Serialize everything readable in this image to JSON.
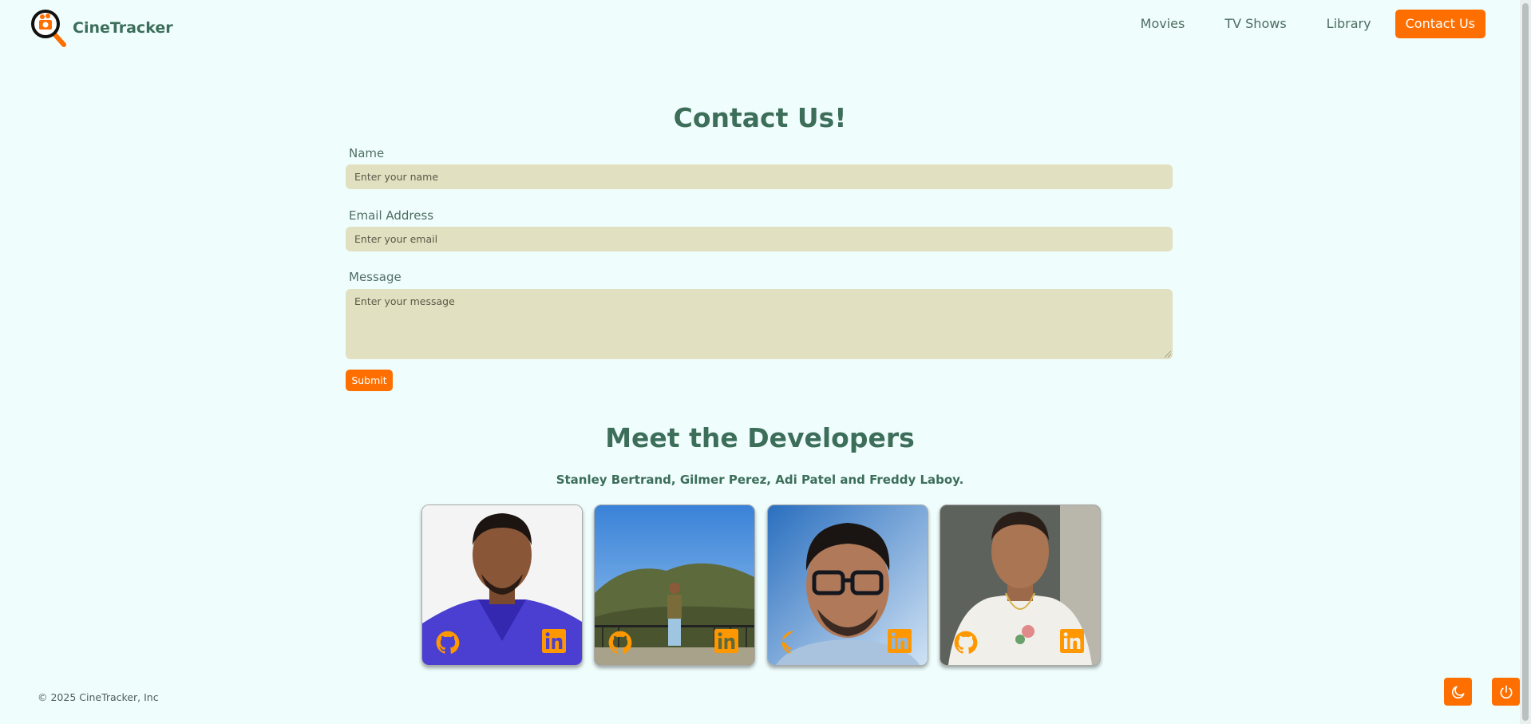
{
  "app": {
    "name": "CineTracker"
  },
  "nav": {
    "links": [
      "Movies",
      "TV Shows",
      "Library"
    ],
    "active": "Contact Us"
  },
  "contact": {
    "title": "Contact Us!",
    "name_label": "Name",
    "name_placeholder": "Enter your name",
    "email_label": "Email Address",
    "email_placeholder": "Enter your email",
    "message_label": "Message",
    "message_placeholder": "Enter your message",
    "submit_label": "Submit"
  },
  "developers": {
    "title": "Meet the Developers",
    "names": "Stanley Bertrand, Gilmer Perez, Adi Patel and Freddy Laboy.",
    "cards": [
      {
        "icons": [
          "github-icon",
          "linkedin-icon"
        ]
      },
      {
        "icons": [
          "github-icon",
          "linkedin-icon"
        ]
      },
      {
        "icons": [
          "github-icon",
          "linkedin-icon"
        ]
      },
      {
        "icons": [
          "github-icon"
        ]
      }
    ]
  },
  "footer": {
    "copyright": "© 2025 CineTracker, Inc",
    "buttons": [
      "moon-icon",
      "power-icon"
    ]
  },
  "colors": {
    "accent": "#ff6f00",
    "background": "#effefd",
    "heading": "#3d6e5a",
    "field": "#e1e0c0"
  }
}
